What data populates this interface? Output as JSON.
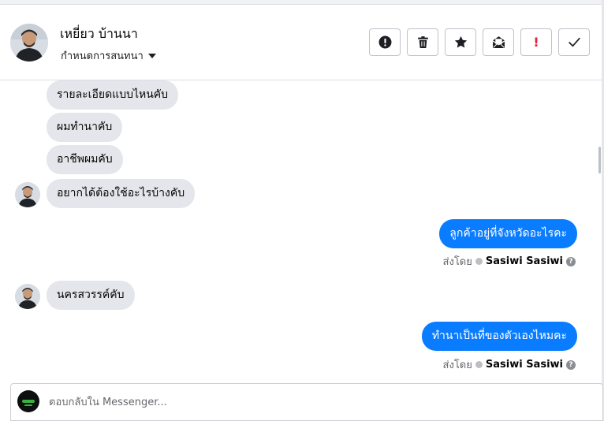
{
  "header": {
    "contact_name": "เหยี่ยว บ้านนา",
    "assign_label": "กำหนดการสนทนา",
    "actions": [
      {
        "name": "report-spam-button",
        "icon": "alert-circle-icon"
      },
      {
        "name": "delete-button",
        "icon": "trash-icon"
      },
      {
        "name": "star-button",
        "icon": "star-icon"
      },
      {
        "name": "mark-unread-button",
        "icon": "envelope-open-icon"
      },
      {
        "name": "follow-up-button",
        "icon": "exclamation-icon",
        "text": "!"
      },
      {
        "name": "mark-done-button",
        "icon": "check-icon"
      }
    ]
  },
  "messages": [
    {
      "direction": "incoming",
      "text": "รายละเอียดแบบไหนคับ"
    },
    {
      "direction": "incoming",
      "text": "ผมทำนาคับ"
    },
    {
      "direction": "incoming",
      "text": "อาชีพผมคับ"
    },
    {
      "direction": "incoming",
      "text": "อยากได้ต้องใช้อะไรบ้างคับ"
    },
    {
      "direction": "outgoing",
      "text": "ลูกค้าอยู่ที่จังหวัดอะไรคะ",
      "sent_by_label": "ส่งโดย",
      "sender": "Sasiwi Sasiwi"
    },
    {
      "direction": "incoming",
      "text": "นครสวรรค์คับ"
    },
    {
      "direction": "outgoing",
      "text": "ทำนาเป็นที่ของตัวเองไหมคะ",
      "sent_by_label": "ส่งโดย",
      "sender": "Sasiwi Sasiwi"
    }
  ],
  "composer": {
    "placeholder": "ตอบกลับใน Messenger..."
  },
  "colors": {
    "outgoing_bubble": "#0a7cff",
    "incoming_bubble": "#e4e6eb",
    "danger": "#e41e3f"
  }
}
